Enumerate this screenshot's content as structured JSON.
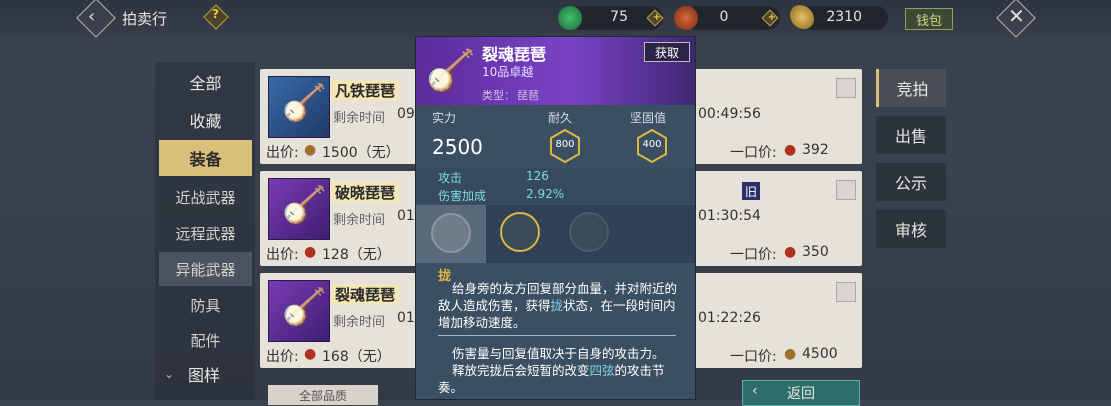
{
  "topbar": {
    "title": "拍卖行",
    "res1": "75",
    "res2": "0",
    "res3": "2310",
    "wallet_label": "钱包"
  },
  "sidebar": {
    "items": [
      "全部",
      "收藏",
      "装备"
    ],
    "subs": [
      "近战武器",
      "远程武器",
      "异能武器",
      "防具",
      "配件"
    ],
    "pattern": "图样"
  },
  "cards": [
    {
      "name": "凡铁琵琶",
      "time_label": "剩余时间",
      "time_prefix": "09",
      "time": "00:49:56",
      "price_label": "出价:",
      "price": "1500（无）",
      "buyout_label": "一口价:",
      "buyout": "392"
    },
    {
      "name": "破晓琵琶",
      "time_label": "剩余时间",
      "time_prefix": "01",
      "time": "01:30:54",
      "price_label": "出价:",
      "price": "128（无）",
      "buyout_label": "一口价:",
      "buyout": "350",
      "tag": "旧"
    },
    {
      "name": "裂魂琵琶",
      "time_label": "剩余时间",
      "time_prefix": "01",
      "time": "01:22:26",
      "price_label": "出价:",
      "price": "168（无）",
      "buyout_label": "一口价:",
      "buyout": "4500"
    }
  ],
  "right_tabs": [
    "竞拍",
    "出售",
    "公示",
    "审核"
  ],
  "bottom": {
    "filter": "全部品质",
    "back": "返回"
  },
  "popup": {
    "name": "裂魂琵琶",
    "grade": "10品卓越",
    "type_label": "类型：",
    "type": "琵琶",
    "obtain": "获取",
    "stat1_label": "实力",
    "stat1": "2500",
    "stat2_label": "耐久",
    "stat2": "800",
    "stat3_label": "坚固值",
    "stat3": "400",
    "attr1_label": "攻击",
    "attr1": "126",
    "attr2_label": "伤害加成",
    "attr2": "2.92%",
    "skill_name": "拢",
    "desc_before": "给身旁的友方回复部分血量，并对附近的敌人造成伤害，获得",
    "desc_highlight": "拢",
    "desc_after": "状态，在一段时间内增加移动速度。",
    "note1": "伤害量与回复值取决于自身的攻击力。",
    "note2_before": "释放完拢后会短暂的改变",
    "note2_highlight": "四弦",
    "note2_after": "的攻击节奏。"
  }
}
